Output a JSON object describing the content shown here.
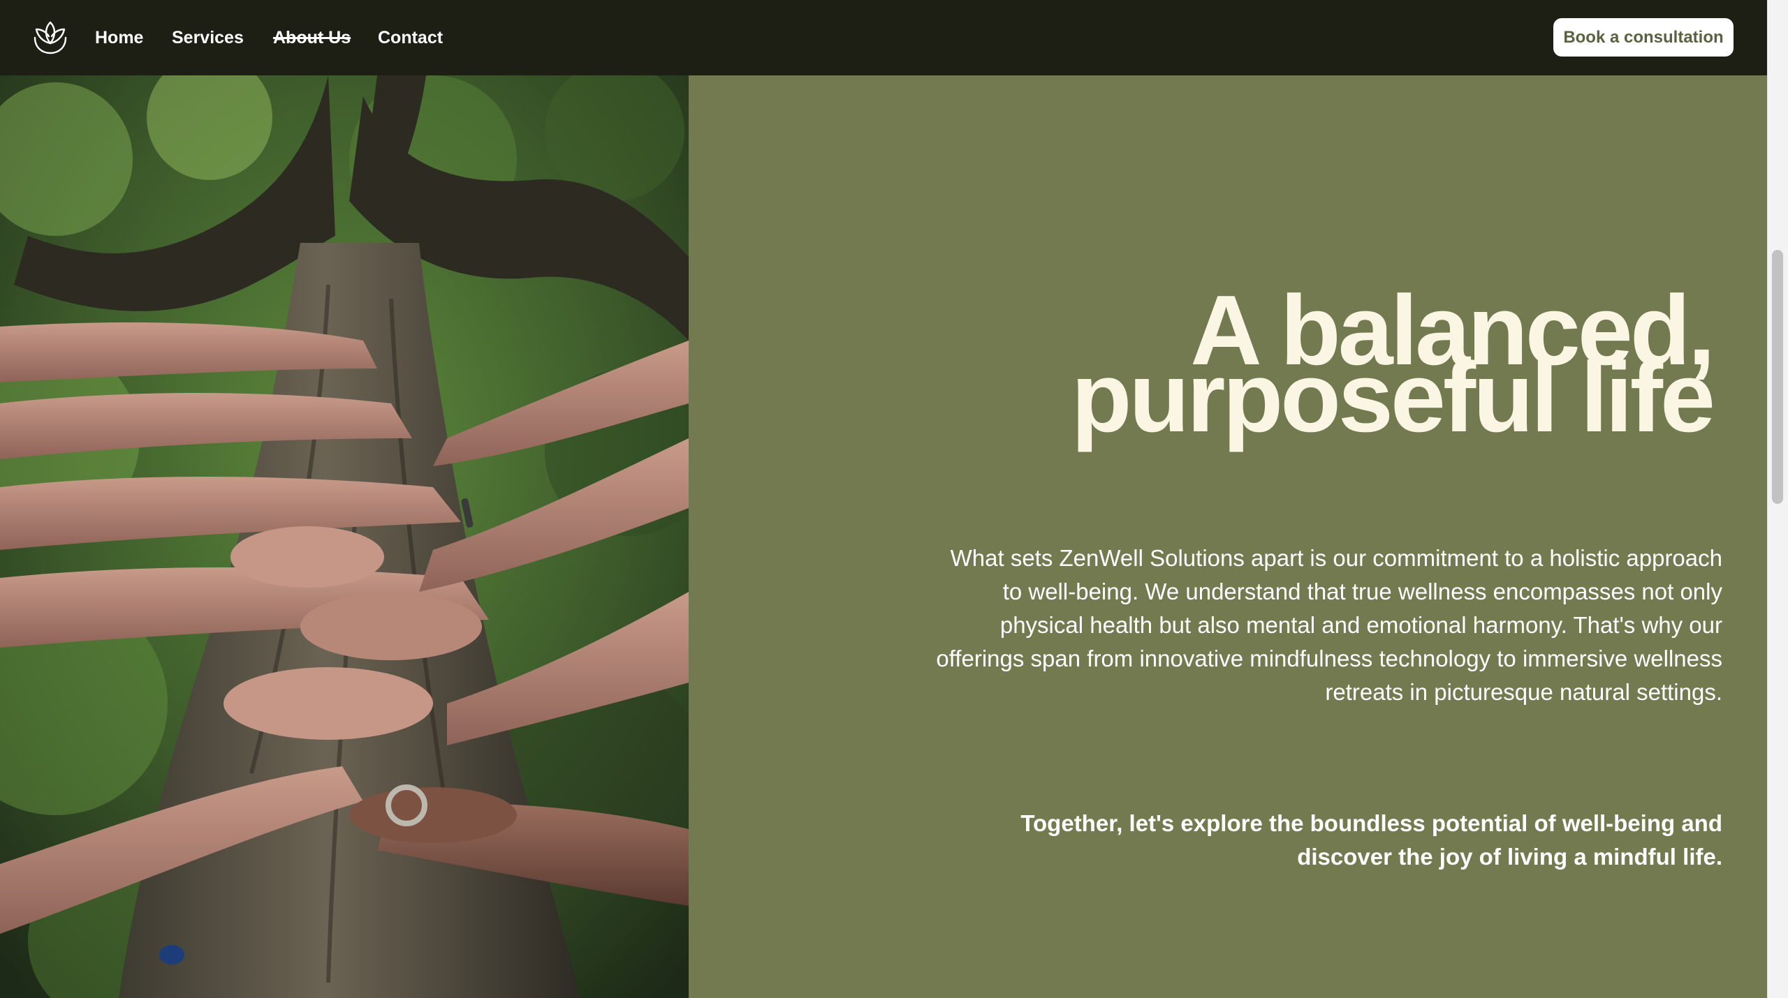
{
  "nav": {
    "logo_icon": "lotus-icon",
    "links": [
      "Home",
      "Services",
      "About Us",
      "Contact"
    ],
    "active_link": "About Us",
    "cta_label": "Book a consultation"
  },
  "hero": {
    "image_description": "hands-on-tree-trunk-photo",
    "headline_line1": "A balanced,",
    "headline_line2": "purposeful life",
    "body": "What sets ZenWell Solutions apart is our commitment to a holistic approach to well-being. We understand that true wellness encompasses not only physical health but also mental and emotional harmony. That's why our offerings span from innovative mindfulness technology to immersive wellness retreats in picturesque natural settings.",
    "tagline": "Together, let's explore the boundless potential of well-being and discover the joy of living a mindful life."
  },
  "colors": {
    "nav_background": "#1d1f15",
    "panel_background": "#737a50",
    "headline_color": "#fbf6e4",
    "cta_text": "#5b6240"
  }
}
